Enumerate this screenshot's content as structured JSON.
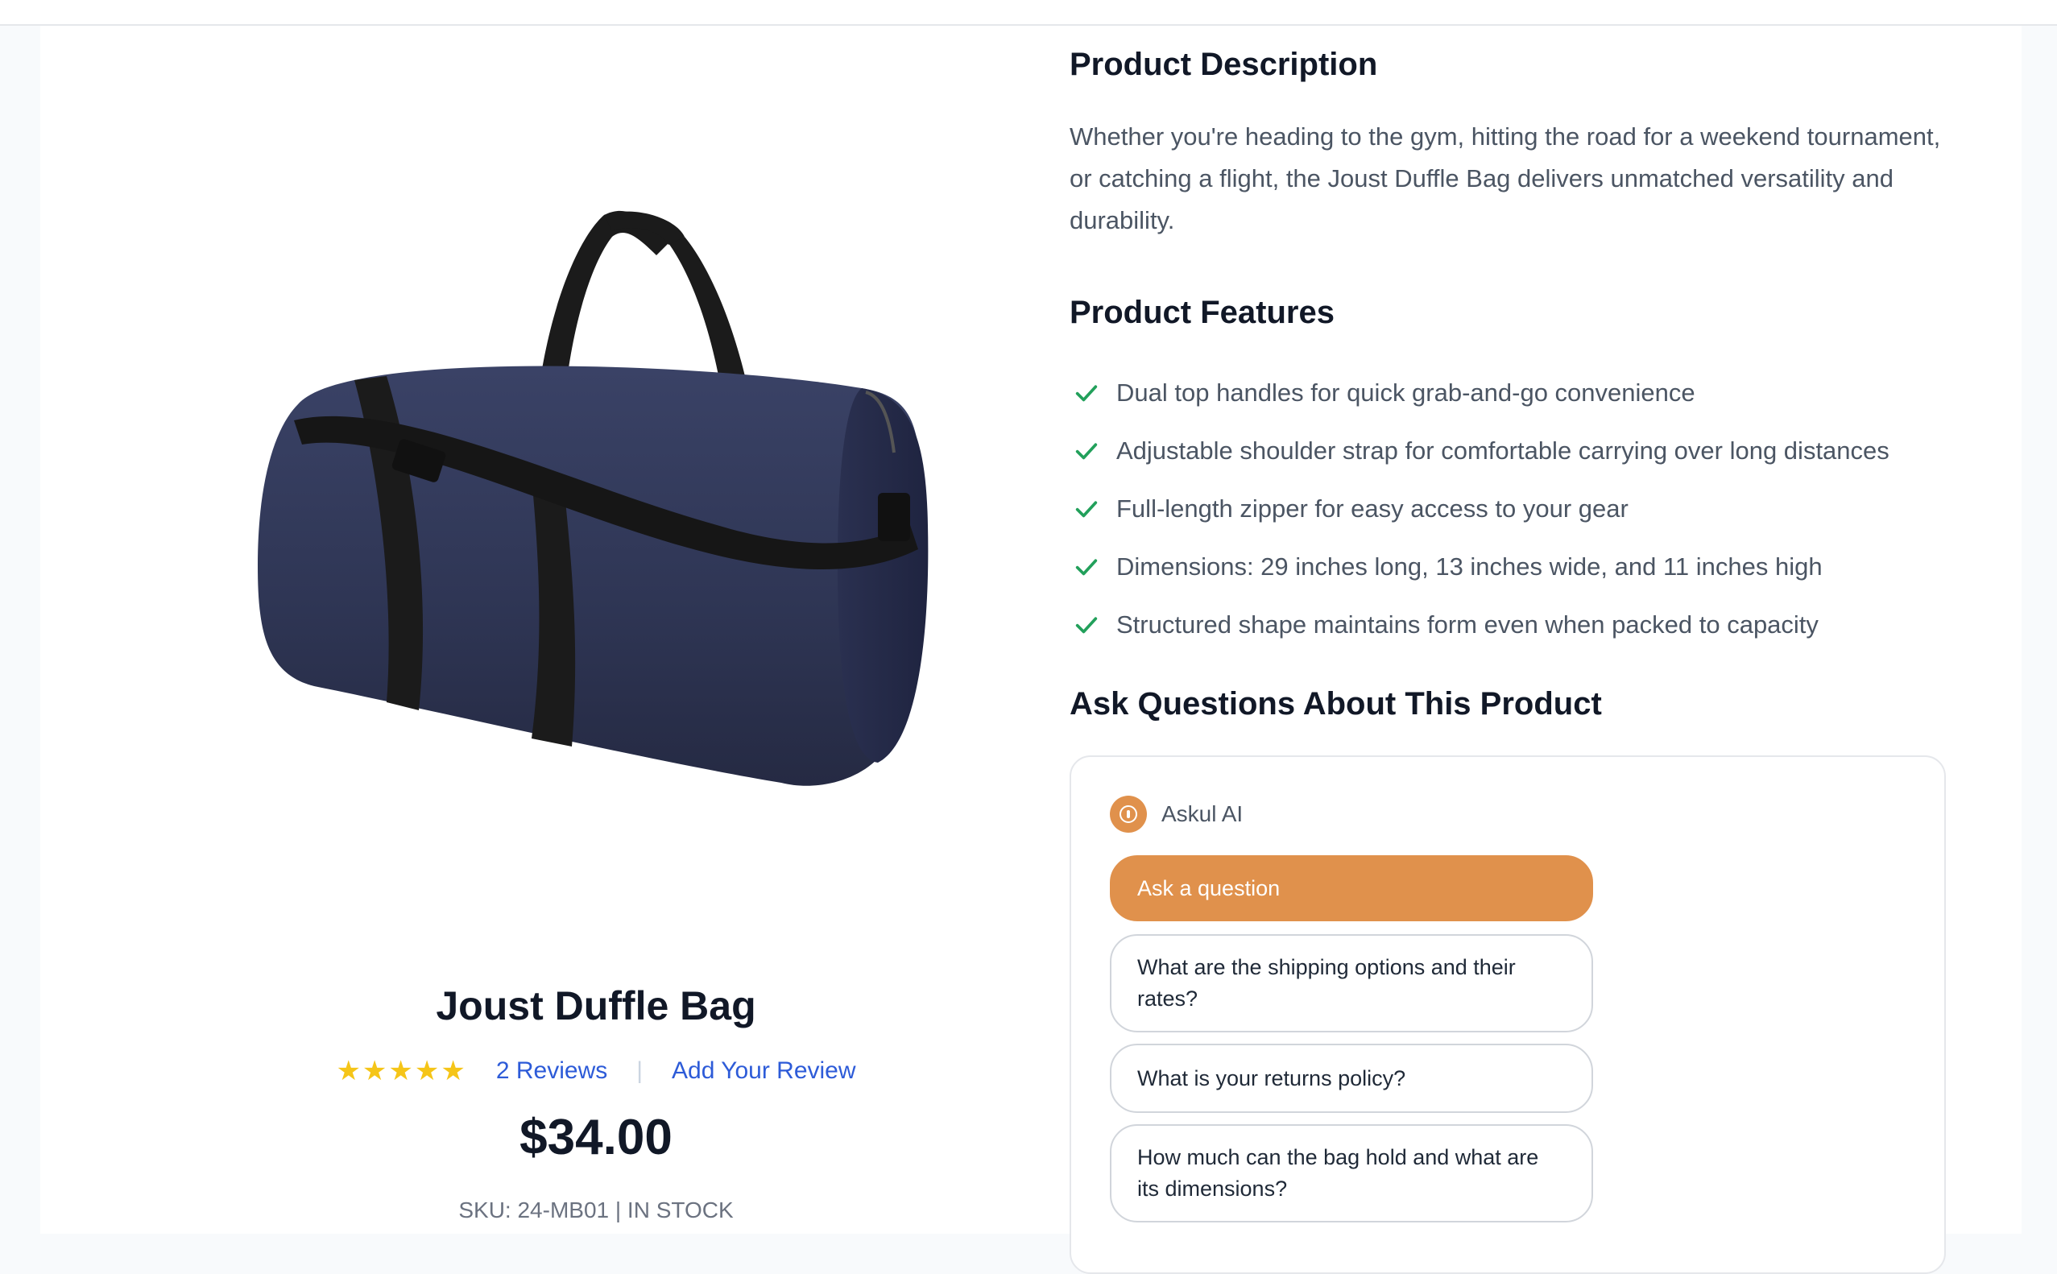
{
  "product": {
    "name": "Joust Duffle Bag",
    "rating_stars": "★★★★★",
    "reviews_label": "2 Reviews",
    "separator": "|",
    "add_review_label": "Add Your Review",
    "price": "$34.00",
    "sku_line": "SKU: 24-MB01 | IN STOCK",
    "rating_value": 5,
    "rating_max": 5
  },
  "description": {
    "heading": "Product Description",
    "text": "Whether you're heading to the gym, hitting the road for a weekend tournament, or catching a flight, the Joust Duffle Bag delivers unmatched versatility and durability."
  },
  "features": {
    "heading": "Product Features",
    "items": [
      "Dual top handles for quick grab-and-go convenience",
      "Adjustable shoulder strap for comfortable carrying over long distances",
      "Full-length zipper for easy access to your gear",
      "Dimensions: 29 inches long, 13 inches wide, and 11 inches high",
      "Structured shape maintains form even when packed to capacity"
    ],
    "icon": "check-icon",
    "icon_color": "#22a05b"
  },
  "ask": {
    "heading": "Ask Questions About This Product",
    "assistant_name": "Askul AI",
    "assistant_icon": "info-icon",
    "primary_label": "Ask a question",
    "questions": [
      "What are the shipping options and their rates?",
      "What is your returns policy?",
      "How much can the bag hold and what are its dimensions?"
    ]
  },
  "colors": {
    "accent": "#e0914c",
    "link": "#2d5bd8",
    "star": "#f5c518",
    "bag": "#2f3655"
  }
}
